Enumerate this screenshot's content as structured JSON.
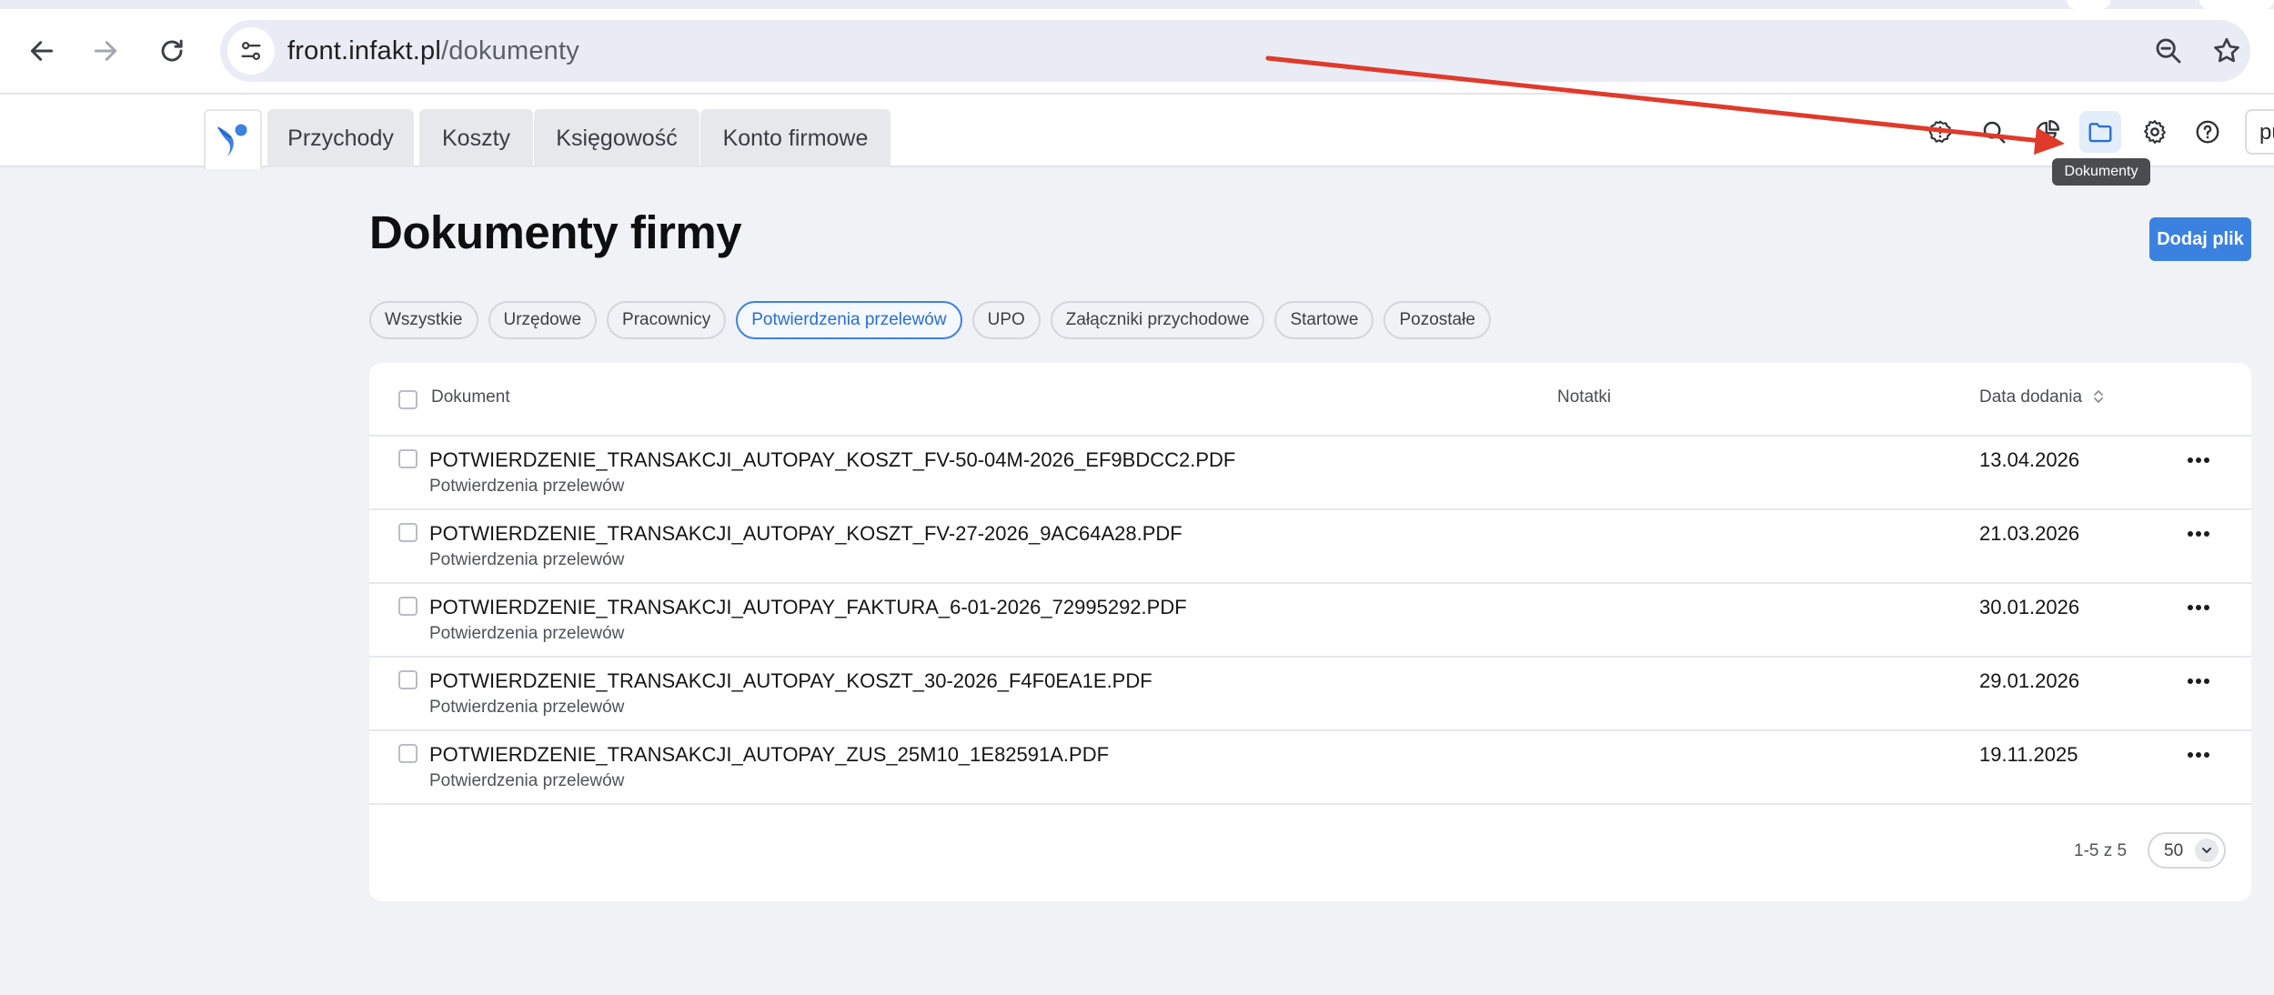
{
  "browser": {
    "url_host": "front.infakt.pl",
    "url_path": "/dokumenty"
  },
  "app": {
    "nav_tabs": [
      "Przychody",
      "Koszty",
      "Księgowość",
      "Konto firmowe"
    ],
    "header_icons": [
      "status-icon",
      "search-icon",
      "reports-icon",
      "folder-icon",
      "gear-icon",
      "help-icon"
    ],
    "active_icon": "folder-icon",
    "user_chip_text": "pu",
    "tooltip": "Dokumenty",
    "accent_color": "#3b82e0",
    "annotation_arrow_color": "#e03a2a"
  },
  "page": {
    "title": "Dokumenty firmy",
    "add_button": "Dodaj plik",
    "filters": [
      "Wszystkie",
      "Urzędowe",
      "Pracownicy",
      "Potwierdzenia przelewów",
      "UPO",
      "Załączniki przychodowe",
      "Startowe",
      "Pozostałe"
    ],
    "active_filter": "Potwierdzenia przelewów"
  },
  "table": {
    "columns": {
      "document": "Dokument",
      "notes": "Notatki",
      "date_added": "Data dodania"
    },
    "rows": [
      {
        "name": "POTWIERDZENIE_TRANSAKCJI_AUTOPAY_KOSZT_FV-50-04M-2026_EF9BDCC2.PDF",
        "type": "Potwierdzenia przelewów",
        "date": "13.04.2026"
      },
      {
        "name": "POTWIERDZENIE_TRANSAKCJI_AUTOPAY_KOSZT_FV-27-2026_9AC64A28.PDF",
        "type": "Potwierdzenia przelewów",
        "date": "21.03.2026"
      },
      {
        "name": "POTWIERDZENIE_TRANSAKCJI_AUTOPAY_FAKTURA_6-01-2026_72995292.PDF",
        "type": "Potwierdzenia przelewów",
        "date": "30.01.2026"
      },
      {
        "name": "POTWIERDZENIE_TRANSAKCJI_AUTOPAY_KOSZT_30-2026_F4F0EA1E.PDF",
        "type": "Potwierdzenia przelewów",
        "date": "29.01.2026"
      },
      {
        "name": "POTWIERDZENIE_TRANSAKCJI_AUTOPAY_ZUS_25M10_1E82591A.PDF",
        "type": "Potwierdzenia przelewów",
        "date": "19.11.2025"
      }
    ],
    "pagination_text": "1-5 z 5",
    "page_size": "50"
  }
}
